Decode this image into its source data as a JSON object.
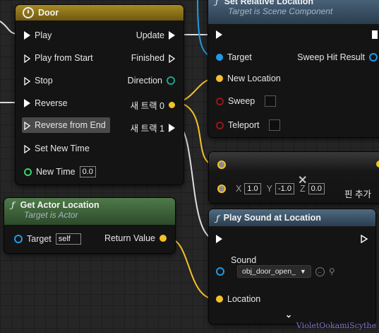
{
  "timeline": {
    "title": "Door",
    "inputs": [
      "Play",
      "Play from Start",
      "Stop",
      "Reverse",
      "Reverse from End",
      "Set New Time"
    ],
    "new_time_label": "New Time",
    "new_time_value": "0.0",
    "outputs": {
      "update": "Update",
      "finished": "Finished",
      "direction": "Direction",
      "track0": "새 트랙 0",
      "track1": "새 트랙 1"
    }
  },
  "set_rel": {
    "title": "Set Relative Location",
    "subtitle": "Target is Scene Component",
    "target": "Target",
    "sweep_hit": "Sweep Hit Result",
    "new_location": "New Location",
    "sweep": "Sweep",
    "teleport": "Teleport"
  },
  "make_vec": {
    "x_label": "X",
    "x_value": "1.0",
    "y_label": "Y",
    "y_value": "-1.0",
    "z_label": "Z",
    "z_value": "0.0",
    "add_pin": "핀 추가"
  },
  "get_actor": {
    "title": "Get Actor Location",
    "subtitle": "Target is Actor",
    "target": "Target",
    "target_value": "self",
    "return": "Return Value"
  },
  "play_sound": {
    "title": "Play Sound at Location",
    "sound": "Sound",
    "sound_value": "obj_door_open_",
    "location": "Location"
  },
  "colors": {
    "exec": "#ffffff",
    "vector": "#f5c12a",
    "object": "#1e9be8",
    "bool": "#8f1a1a",
    "float": "#36d46a",
    "direction": "#1aa38a",
    "timeline_header": "#8a6f18",
    "function_header": "#3f5a72",
    "pure_header": "#3d6a3a"
  },
  "watermark": "VioletOokamiScythe"
}
